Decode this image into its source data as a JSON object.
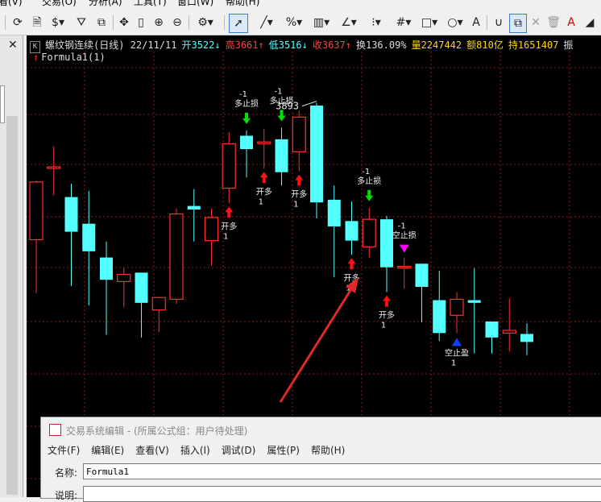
{
  "menu": [
    "查看(V)",
    "交易(O)",
    "分析(A)",
    "工具(T)",
    "窗口(W)",
    "帮助(H)"
  ],
  "toolbar": {
    "icons": [
      "refresh-icon",
      "document-icon",
      "dollar-icon",
      "filter-icon",
      "new-window-icon",
      "crosshair-icon",
      "ruler-icon",
      "zoom-in-icon",
      "zoom-out-icon",
      "settings-icon",
      "cursor-icon",
      "line-icon",
      "percent-icon",
      "bars-icon",
      "angle-icon",
      "period-icon",
      "grid-icon",
      "rectangle-icon",
      "circle-icon",
      "text-icon",
      "magnet-icon",
      "copy-icon",
      "delete-icon",
      "close-icon",
      "text-color-icon"
    ]
  },
  "info": {
    "k_label": "K",
    "name": "螺纹钢连续(日线) 22/11/11",
    "open": "开3522↓",
    "high": "高3661↑",
    "low": "低3516↓",
    "close": "收3637↑",
    "turnover_rate": "换136.09%",
    "volume": "量2247442",
    "amount": "额810亿",
    "hold": "持1651407",
    "more": "振"
  },
  "formula": {
    "arrow": "↑",
    "name": "Formula1(1)"
  },
  "colors": {
    "up": "#ff3030",
    "down": "#54ffff",
    "grid": "#8a1c1c",
    "signal_long": "#ff1010",
    "signal_stop": "#00e000",
    "signal_short_stop": "#ff00ff",
    "signal_blue": "#1040ff"
  },
  "chart_data": {
    "type": "candlestick",
    "title": "螺纹钢连续(日线)",
    "peak_label": "3893",
    "candles": [
      {
        "o": 3845,
        "c": 3910,
        "h": 3912,
        "l": 3785,
        "color": "up"
      },
      {
        "o": 3926,
        "c": 3927,
        "h": 3950,
        "l": 3895,
        "color": "up"
      },
      {
        "o": 3893,
        "c": 3854,
        "h": 3908,
        "l": 3793,
        "color": "down"
      },
      {
        "o": 3863,
        "c": 3832,
        "h": 3900,
        "l": 3771,
        "color": "down"
      },
      {
        "o": 3825,
        "c": 3800,
        "h": 3843,
        "l": 3738,
        "color": "down"
      },
      {
        "o": 3806,
        "c": 3798,
        "h": 3813,
        "l": 3769,
        "color": "up"
      },
      {
        "o": 3808,
        "c": 3774,
        "h": 3808,
        "l": 3735,
        "color": "down"
      },
      {
        "o": 3766,
        "c": 3780,
        "h": 3781,
        "l": 3741,
        "color": "up"
      },
      {
        "o": 3778,
        "c": 3874,
        "h": 3880,
        "l": 3773,
        "color": "up"
      },
      {
        "o": 3883,
        "c": 3879,
        "h": 3902,
        "l": 3843,
        "color": "down"
      },
      {
        "o": 3844,
        "c": 3870,
        "h": 3880,
        "l": 3816,
        "color": "up"
      },
      {
        "o": 3903,
        "c": 3953,
        "h": 3966,
        "l": 3886,
        "color": "up"
      },
      {
        "o": 3962,
        "c": 3947,
        "h": 3968,
        "l": 3915,
        "color": "down"
      },
      {
        "o": 3955,
        "c": 3954,
        "h": 3970,
        "l": 3925,
        "color": "up"
      },
      {
        "o": 3958,
        "c": 3921,
        "h": 3971,
        "l": 3906,
        "color": "down"
      },
      {
        "o": 3944,
        "c": 3983,
        "h": 3990,
        "l": 3922,
        "color": "up"
      },
      {
        "o": 3996,
        "c": 3887,
        "h": 3999,
        "l": 3869,
        "color": "down"
      },
      {
        "o": 3890,
        "c": 3860,
        "h": 3906,
        "l": 3803,
        "color": "down"
      },
      {
        "o": 3866,
        "c": 3844,
        "h": 3888,
        "l": 3828,
        "color": "down"
      },
      {
        "o": 3837,
        "c": 3868,
        "h": 3881,
        "l": 3825,
        "color": "up"
      },
      {
        "o": 3868,
        "c": 3814,
        "h": 3872,
        "l": 3786,
        "color": "down"
      },
      {
        "o": 3815,
        "c": 3815,
        "h": 3825,
        "l": 3790,
        "color": "up"
      },
      {
        "o": 3818,
        "c": 3792,
        "h": 3818,
        "l": 3752,
        "color": "down"
      },
      {
        "o": 3777,
        "c": 3740,
        "h": 3810,
        "l": 3731,
        "color": "down"
      },
      {
        "o": 3760,
        "c": 3778,
        "h": 3786,
        "l": 3740,
        "color": "up"
      },
      {
        "o": 3774,
        "c": 3777,
        "h": 3813,
        "l": 3717,
        "color": "down"
      },
      {
        "o": 3753,
        "c": 3735,
        "h": 3753,
        "l": 3717,
        "color": "down"
      },
      {
        "o": 3740,
        "c": 3743,
        "h": 3779,
        "l": 3719,
        "color": "up"
      },
      {
        "o": 3739,
        "c": 3730,
        "h": 3751,
        "l": 3715,
        "color": "down"
      }
    ],
    "signals": [
      {
        "bar": 11,
        "type": "long",
        "label": "开多",
        "qty": "1"
      },
      {
        "bar": 12,
        "type": "stop",
        "label": "多止损",
        "qty": "-1"
      },
      {
        "bar": 13,
        "type": "long",
        "label": "开多",
        "qty": "1"
      },
      {
        "bar": 14,
        "type": "stop",
        "label": "多止损",
        "qty": "-1"
      },
      {
        "bar": 15,
        "type": "long",
        "label": "开多",
        "qty": "1"
      },
      {
        "bar": 18,
        "type": "long",
        "label": "开多",
        "qty": "1"
      },
      {
        "bar": 19,
        "type": "stop",
        "label": "多止损",
        "qty": "-1"
      },
      {
        "bar": 20,
        "type": "long",
        "label": "开多",
        "qty": "1"
      },
      {
        "bar": 21,
        "type": "short_stop",
        "label": "空止损",
        "qty": "-1"
      },
      {
        "bar": 24,
        "type": "short",
        "label": "空止盈",
        "qty": "1"
      }
    ]
  },
  "dialog": {
    "title": "交易系统编辑 - (所属公式组：用户待处理)",
    "menu": [
      "文件(F)",
      "编辑(E)",
      "查看(V)",
      "插入(I)",
      "调试(D)",
      "属性(P)",
      "帮助(H)"
    ],
    "name_label": "名称:",
    "name_value": "Formula1",
    "desc_label": "说明:"
  }
}
